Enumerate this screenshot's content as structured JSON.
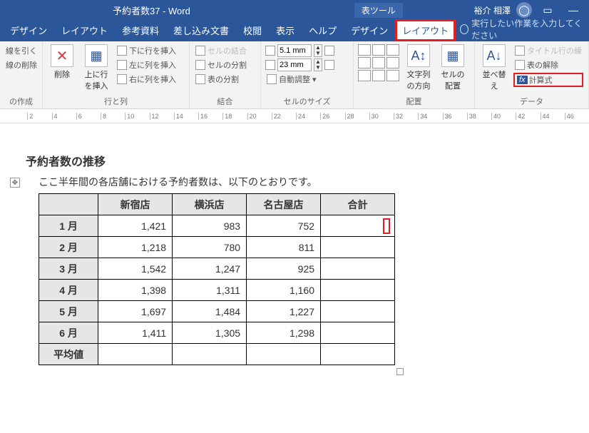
{
  "titlebar": {
    "doc_title": "予約者数37 - Word",
    "table_tools": "表ツール",
    "user_name": "裕介 相澤"
  },
  "tabs": {
    "design": "デザイン",
    "layout": "レイアウト",
    "references": "参考資料",
    "mailings": "差し込み文書",
    "review": "校閲",
    "view": "表示",
    "help": "ヘルプ",
    "table_design": "デザイン",
    "table_layout": "レイアウト",
    "tell_me": "実行したい作業を入力してください"
  },
  "ribbon": {
    "grid": {
      "draw": "線を引く",
      "erase": "線の削除",
      "group": "の作成"
    },
    "rowscols": {
      "delete": "削除",
      "insert_above": "上に行を挿入",
      "insert_below": "下に行を挿入",
      "insert_left": "左に列を挿入",
      "insert_right": "右に列を挿入",
      "group": "行と列"
    },
    "merge": {
      "merge_cells": "セルの結合",
      "split_cells": "セルの分割",
      "split_table": "表の分割",
      "group": "結合"
    },
    "cellsize": {
      "height_val": "5.1 mm",
      "width_val": "23 mm",
      "autofit": "自動調整",
      "group": "セルのサイズ"
    },
    "alignment": {
      "text_direction": "文字列の方向",
      "cell_margins": "セルの配置",
      "group": "配置"
    },
    "data": {
      "sort": "並べ替え",
      "repeat_header": "タイトル行の繰",
      "convert": "表の解除",
      "formula": "計算式",
      "group": "データ"
    }
  },
  "ruler_marks": [
    "",
    "2",
    "4",
    "6",
    "8",
    "10",
    "12",
    "14",
    "16",
    "18",
    "20",
    "22",
    "24",
    "26",
    "28",
    "30",
    "32",
    "34",
    "36",
    "38",
    "40",
    "42",
    "44",
    "46"
  ],
  "document": {
    "heading": "予約者数の推移",
    "paragraph": "ここ半年間の各店舗における予約者数は、以下のとおりです。"
  },
  "table": {
    "headers": [
      "",
      "新宿店",
      "横浜店",
      "名古屋店",
      "合計"
    ],
    "rows": [
      {
        "label": "1 月",
        "values": [
          "1,421",
          "983",
          "752"
        ],
        "cursor": true
      },
      {
        "label": "2 月",
        "values": [
          "1,218",
          "780",
          "811"
        ]
      },
      {
        "label": "3 月",
        "values": [
          "1,542",
          "1,247",
          "925"
        ]
      },
      {
        "label": "4 月",
        "values": [
          "1,398",
          "1,311",
          "1,160"
        ]
      },
      {
        "label": "5 月",
        "values": [
          "1,697",
          "1,484",
          "1,227"
        ]
      },
      {
        "label": "6 月",
        "values": [
          "1,411",
          "1,305",
          "1,298"
        ]
      },
      {
        "label": "平均値",
        "values": [
          "",
          "",
          ""
        ]
      }
    ]
  },
  "chart_data": {
    "type": "table",
    "title": "予約者数の推移",
    "columns": [
      "新宿店",
      "横浜店",
      "名古屋店"
    ],
    "rows": [
      "1 月",
      "2 月",
      "3 月",
      "4 月",
      "5 月",
      "6 月"
    ],
    "values": [
      [
        1421,
        983,
        752
      ],
      [
        1218,
        780,
        811
      ],
      [
        1542,
        1247,
        925
      ],
      [
        1398,
        1311,
        1160
      ],
      [
        1697,
        1484,
        1227
      ],
      [
        1411,
        1305,
        1298
      ]
    ]
  }
}
